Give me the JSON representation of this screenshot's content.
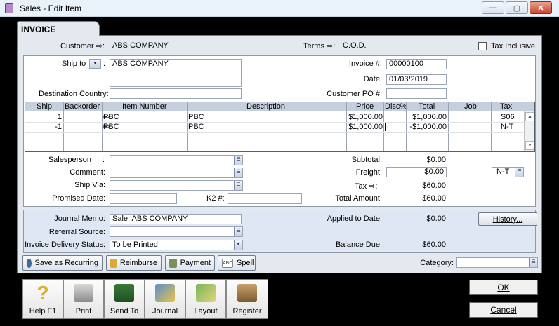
{
  "window": {
    "title": "Sales - Edit Item",
    "min": "—",
    "max": "▢",
    "close": "✕"
  },
  "tab": {
    "label": "INVOICE"
  },
  "header": {
    "customer_label": "Customer",
    "customer_value": "ABS COMPANY",
    "terms_label": "Terms",
    "terms_value": "C.O.D.",
    "tax_inclusive_label": "Tax Inclusive"
  },
  "shipping": {
    "ship_to_label": "Ship to",
    "ship_to_value": "ABS COMPANY",
    "destination_country_label": "Destination Country:",
    "destination_country_value": ""
  },
  "invoice_info": {
    "invoice_no_label": "Invoice #:",
    "invoice_no": "00000100",
    "date_label": "Date:",
    "date": "01/03/2019",
    "customer_po_label": "Customer PO #:",
    "customer_po": ""
  },
  "grid": {
    "columns": [
      "Ship",
      "Backorder",
      "Item Number",
      "Description",
      "Price",
      "Disc%",
      "Total",
      "Job",
      "Tax"
    ],
    "rows": [
      {
        "ship": "1",
        "backorder": "",
        "item": "PBC",
        "description": "PBC",
        "price": "$1,000.00",
        "disc": "",
        "total": "$1,000.00",
        "job": "",
        "tax": "S06"
      },
      {
        "ship": "-1",
        "backorder": "",
        "item": "PBC",
        "description": "PBC",
        "price": "$1,000.00",
        "disc": "",
        "total": "-$1,000.00",
        "job": "",
        "tax": "N-T"
      }
    ]
  },
  "details": {
    "salesperson_label": "Salesperson",
    "comment_label": "Comment:",
    "ship_via_label": "Ship Via:",
    "promised_date_label": "Promised Date:",
    "k2_label": "K2 #:"
  },
  "totals": {
    "subtotal_label": "Subtotal:",
    "subtotal": "$0.00",
    "freight_label": "Freight:",
    "freight": "$0.00",
    "freight_tax": "N-T",
    "tax_label": "Tax",
    "tax": "$60.00",
    "total_label": "Total Amount:",
    "total": "$60.00"
  },
  "memo": {
    "journal_memo_label": "Journal Memo:",
    "journal_memo": "Sale; ABS COMPANY",
    "referral_label": "Referral Source:",
    "delivery_label": "Invoice Delivery Status:",
    "delivery_value": "To be Printed",
    "applied_label": "Applied to Date:",
    "applied": "$0.00",
    "history_button": "History...",
    "balance_label": "Balance Due:",
    "balance": "$60.00"
  },
  "actions": {
    "save_recurring": "Save as Recurring",
    "reimburse": "Reimburse",
    "payment": "Payment",
    "spell": "Spell",
    "category_label": "Category:"
  },
  "toolbar": {
    "help": "Help F1",
    "print": "Print",
    "send_to": "Send To",
    "journal": "Journal",
    "layout": "Layout",
    "register": "Register"
  },
  "dialog": {
    "ok": "OK",
    "cancel": "Cancel"
  }
}
